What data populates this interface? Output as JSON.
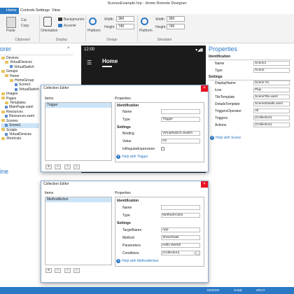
{
  "window": {
    "title": "ScenesExample.hrp - Home Remote Designer"
  },
  "menu": {
    "file": "",
    "home": "Home",
    "controls": "Controls",
    "settings": "Settings",
    "view": "View"
  },
  "ribbon": {
    "cut": "Cut",
    "copy": "Copy",
    "paste": "Paste",
    "clipboard_group": "Clipboard",
    "orientation": "Orientation",
    "background": "Background",
    "accent": "Accent",
    "display_group": "Display",
    "platform1": "Platform",
    "width_label": "Width",
    "width_value": "360",
    "height_label": "Height",
    "height_value": "740",
    "design_group": "Design",
    "platform2": "Platform",
    "width2_label": "Width",
    "width2_value": "360",
    "height2_label": "Height",
    "height2_value": "740",
    "simulator_group": "Simulator"
  },
  "explorer": {
    "title": "orer",
    "items": [
      "Devices",
      "VirtualDevices",
      "VirtualSwitch",
      "Groups",
      "Home",
      "HomeGroup",
      "Scene1",
      "VirtualSwitch",
      "Images",
      "Pages",
      "Templates",
      "MainPage.xaml",
      "Resources",
      "Resources.xaml",
      "Scenes",
      "Scene1",
      "Scripts",
      "VirtualDevices",
      "Shortcuts"
    ]
  },
  "bottom_panel": {
    "title": "ine"
  },
  "phone": {
    "time": "12:00",
    "title": "Home"
  },
  "properties": {
    "title": "Properties",
    "identification": "Identification",
    "name_label": "Name",
    "name_value": "Scene1",
    "type_label": "Type",
    "type_value": "Scene",
    "settings": "Settings",
    "rows": [
      {
        "label": "DisplayName",
        "value": "Scene #1"
      },
      {
        "label": "Icon",
        "value": "Play"
      },
      {
        "label": "TileTemplate",
        "value": "SceneTile.xaml"
      },
      {
        "label": "DetailsTemplate",
        "value": "SceneDetails.xaml"
      },
      {
        "label": "TriggersOperator",
        "value": "All"
      },
      {
        "label": "Triggers",
        "value": "(Collection)"
      },
      {
        "label": "Actions",
        "value": "(Collection)"
      }
    ],
    "help": "Help with Scene"
  },
  "dialog1": {
    "title": "Collection Editor",
    "items_label": "Items",
    "item": "Trigger",
    "props_label": "Properties",
    "identification": "Identification",
    "name_label": "Name",
    "name_value": "",
    "type_label": "Type",
    "type_value": "Trigger",
    "settings": "Settings",
    "binding_label": "Binding",
    "binding_value": "VirtualSwitch.Switch",
    "value_label": "Value",
    "value_value": "On",
    "isregular_label": "IsRegularExpression",
    "help": "Help with Trigger"
  },
  "dialog2": {
    "title": "Collection Editor",
    "items_label": "Items",
    "item": "MethodAction",
    "props_label": "Properties",
    "identification": "Identification",
    "name_label": "Name",
    "name_value": "",
    "type_label": "Type",
    "type_value": "MethodAction",
    "settings": "Settings",
    "target_label": "TargetName",
    "target_value": "App",
    "method_label": "Method",
    "method_value": "ShowToast",
    "params_label": "Parameters",
    "params_value": "Hello World!",
    "cond_label": "Conditions",
    "cond_value": "(Collection)",
    "help": "Help with MethodAction"
  },
  "status": {
    "design": "DESIGN",
    "xaml": "XAML",
    "split": "SPLIT"
  },
  "colors": {
    "accent": "#2b78c5",
    "close": "#e81123",
    "phone_bg": "#1b1b1b"
  }
}
